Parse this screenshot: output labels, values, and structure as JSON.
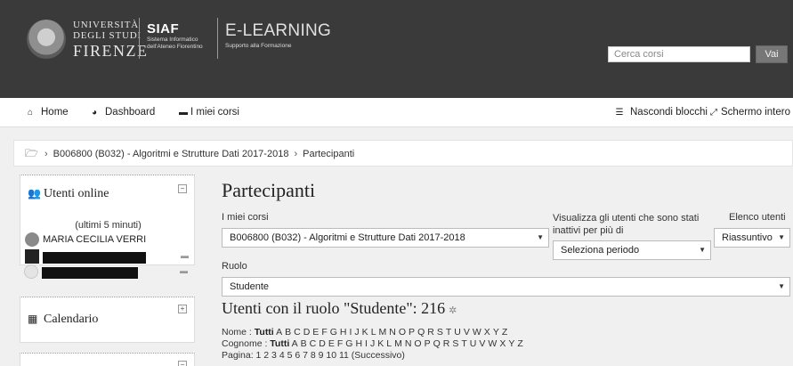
{
  "header": {
    "university": [
      "UNIVERSITÀ",
      "DEGLI STUDI",
      "FIRENZE"
    ],
    "siaf_title": "SIAF",
    "siaf_sub": [
      "Sistema Informatico",
      "dell'Ateneo Fiorentino"
    ],
    "elearning_title": "E-LEARNING",
    "elearning_sub": "Supporto alla Formazione",
    "search_placeholder": "Cerca corsi",
    "search_button": "Vai"
  },
  "nav": {
    "home": "Home",
    "dashboard": "Dashboard",
    "my_courses": "I miei corsi",
    "hide_blocks": "Nascondi blocchi",
    "fullscreen": "Schermo intero"
  },
  "breadcrumb": {
    "course": "B006800 (B032) - Algoritmi e Strutture Dati 2017-2018",
    "current": "Partecipanti"
  },
  "blocks": {
    "online": {
      "title": "Utenti online",
      "subtitle": "(ultimi 5 minuti)",
      "users": [
        "MARIA CECILIA VERRI"
      ]
    },
    "calendar": {
      "title": "Calendario"
    }
  },
  "main": {
    "title": "Partecipanti",
    "my_courses_label": "I miei corsi",
    "course_select": "B006800 (B032) - Algoritmi e Strutture Dati 2017-2018",
    "inactive_label": "Visualizza gli utenti che sono stati inattivi per più di",
    "period_select": "Seleziona periodo",
    "list_label": "Elenco utenti",
    "list_select": "Riassuntivo",
    "role_label": "Ruolo",
    "role_select": "Studente",
    "role_heading": "Utenti con il ruolo \"Studente\": 216",
    "name_label": "Nome :",
    "surname_label": "Cognome :",
    "all": "Tutti",
    "letters": [
      "A",
      "B",
      "C",
      "D",
      "E",
      "F",
      "G",
      "H",
      "I",
      "J",
      "K",
      "L",
      "M",
      "N",
      "O",
      "P",
      "Q",
      "R",
      "S",
      "T",
      "U",
      "V",
      "W",
      "X",
      "Y",
      "Z"
    ],
    "page_label": "Pagina:",
    "pages": "1 2 3 4 5 6 7 8 9 10 11",
    "next": "(Successivo)"
  },
  "icons": {
    "home": "home-icon",
    "dashboard": "dashboard-icon",
    "courses": "courses-icon",
    "hide_blocks": "hide-blocks-icon",
    "fullscreen": "fullscreen-icon",
    "folder": "folder-icon",
    "users": "users-icon",
    "calendar": "calendar-icon",
    "message": "message-icon",
    "settings": "gear-icon"
  },
  "colors": {
    "header_bg": "#3a3a3a",
    "page_bg": "#f0f0f0",
    "button_bg": "#777777"
  }
}
